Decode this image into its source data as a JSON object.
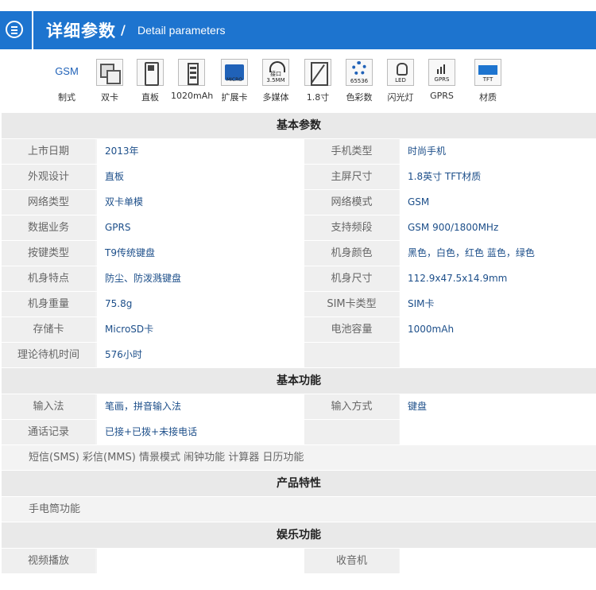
{
  "header": {
    "title": "详细参数",
    "slash": "/",
    "subtitle": "Detail parameters"
  },
  "icons": [
    {
      "name": "gsm-icon",
      "text": "GSM",
      "label": "制式"
    },
    {
      "name": "dual-sim-icon",
      "text": "",
      "label": "双卡"
    },
    {
      "name": "bar-phone-icon",
      "text": "",
      "label": "直板"
    },
    {
      "name": "battery-icon",
      "text": "",
      "label": "1020mAh"
    },
    {
      "name": "micro-sd-icon",
      "text": "MICRO",
      "label": "扩展卡"
    },
    {
      "name": "headphone-icon",
      "text": "接口 3.5MM",
      "label": "多媒体"
    },
    {
      "name": "screen-size-icon",
      "text": "",
      "label": "1.8寸"
    },
    {
      "name": "color-icon",
      "text": "65536",
      "label": "色彩数"
    },
    {
      "name": "led-icon",
      "text": "LED",
      "label": "闪光灯"
    },
    {
      "name": "gprs-icon",
      "text": "GPRS",
      "label": "GPRS"
    },
    {
      "name": "tft-icon",
      "text": "TFT",
      "label": "材质"
    }
  ],
  "sections": {
    "basic": {
      "title": "基本参数",
      "rows": [
        [
          "上市日期",
          "2013年",
          "手机类型",
          "时尚手机"
        ],
        [
          "外观设计",
          "直板",
          "主屏尺寸",
          "1.8英寸 TFT材质"
        ],
        [
          "网络类型",
          "双卡单模",
          "网络模式",
          "GSM"
        ],
        [
          "数据业务",
          "GPRS",
          "支持频段",
          "GSM 900/1800MHz"
        ],
        [
          "按键类型",
          "T9传统键盘",
          "机身颜色",
          "黑色，白色，红色 蓝色，绿色"
        ],
        [
          "机身特点",
          "防尘、防泼溅键盘",
          "机身尺寸",
          "112.9x47.5x14.9mm"
        ],
        [
          "机身重量",
          "75.8g",
          "SIM卡类型",
          "SIM卡"
        ],
        [
          "存储卡",
          "MicroSD卡",
          "电池容量",
          "1000mAh"
        ],
        [
          "理论待机时间",
          "576小时",
          "",
          ""
        ]
      ]
    },
    "function": {
      "title": "基本功能",
      "rows": [
        [
          "输入法",
          "笔画，拼音输入法",
          "输入方式",
          "键盘"
        ],
        [
          "通话记录",
          "已接+已拨+未接电话",
          "",
          ""
        ]
      ],
      "note": "短信(SMS) 彩信(MMS) 情景模式 闹钟功能 计算器 日历功能"
    },
    "feature": {
      "title": "产品特性",
      "note": "手电筒功能"
    },
    "entertainment": {
      "title": "娱乐功能",
      "rows": [
        [
          "视频播放",
          "",
          "收音机",
          ""
        ]
      ]
    }
  }
}
